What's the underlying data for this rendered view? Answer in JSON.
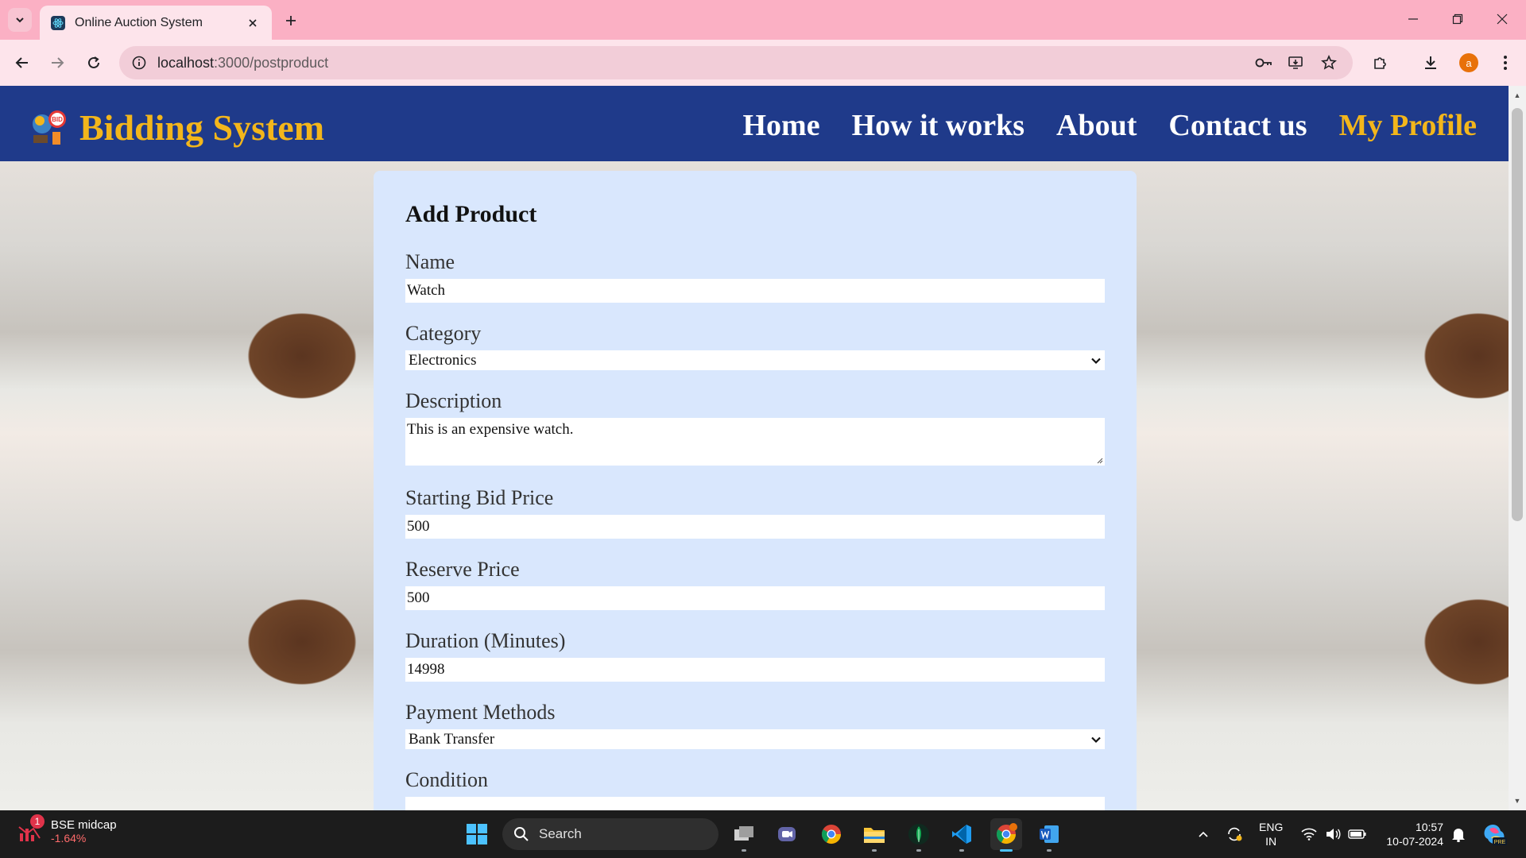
{
  "browser": {
    "tab_title": "Online Auction System",
    "url_host": "localhost",
    "url_path": ":3000/postproduct",
    "profile_initial": "a"
  },
  "site": {
    "brand": "Bidding System",
    "logo_badge": "BID",
    "nav": [
      {
        "label": "Home"
      },
      {
        "label": "How it works"
      },
      {
        "label": "About"
      },
      {
        "label": "Contact us"
      },
      {
        "label": "My Profile"
      }
    ]
  },
  "form": {
    "title": "Add Product",
    "fields": {
      "name": {
        "label": "Name",
        "value": "Watch"
      },
      "category": {
        "label": "Category",
        "value": "Electronics"
      },
      "description": {
        "label": "Description",
        "value": "This is an expensive watch."
      },
      "starting_bid": {
        "label": "Starting Bid Price",
        "value": "500"
      },
      "reserve_price": {
        "label": "Reserve Price",
        "value": "500"
      },
      "duration": {
        "label": "Duration (Minutes)",
        "value": "14998"
      },
      "payment": {
        "label": "Payment Methods",
        "value": "Bank Transfer"
      },
      "condition": {
        "label": "Condition",
        "value": ""
      }
    }
  },
  "taskbar": {
    "widget_badge": "1",
    "widget_title": "BSE midcap",
    "widget_value": "-1.64%",
    "search_label": "Search",
    "lang_line1": "ENG",
    "lang_line2": "IN",
    "time": "10:57",
    "date": "10-07-2024",
    "copilot_badge": "PRE"
  },
  "colors": {
    "navbar": "#1f3a8a",
    "brand": "#f3b61b",
    "card": "#d9e7fd",
    "tabbar": "#fbb0c4"
  }
}
